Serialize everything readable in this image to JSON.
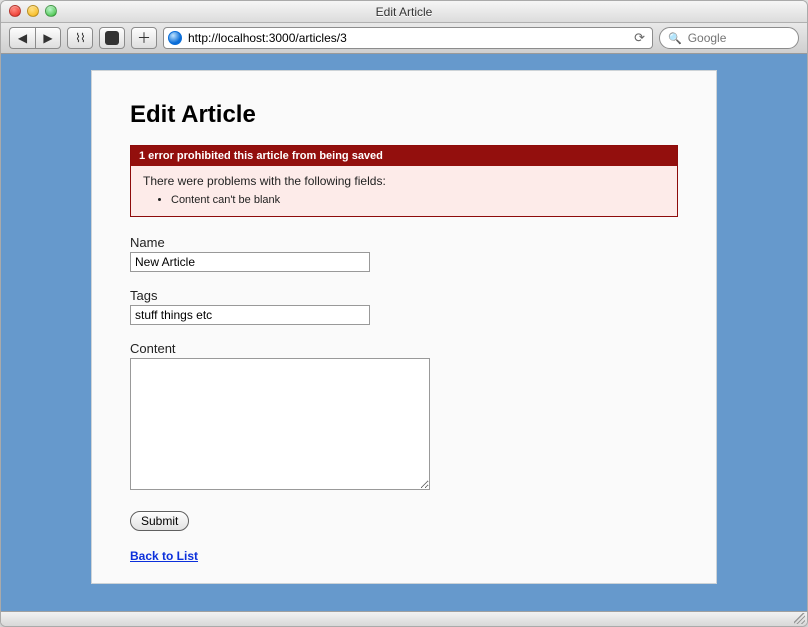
{
  "window": {
    "title": "Edit Article"
  },
  "toolbar": {
    "url": "http://localhost:3000/articles/3",
    "search_placeholder": "Google"
  },
  "page": {
    "heading": "Edit Article",
    "error": {
      "header": "1 error prohibited this article from being saved",
      "intro": "There were problems with the following fields:",
      "items": [
        "Content can't be blank"
      ]
    },
    "form": {
      "name_label": "Name",
      "name_value": "New Article",
      "tags_label": "Tags",
      "tags_value": "stuff things etc",
      "content_label": "Content",
      "content_value": "",
      "submit_label": "Submit"
    },
    "back_link_label": "Back to List"
  }
}
